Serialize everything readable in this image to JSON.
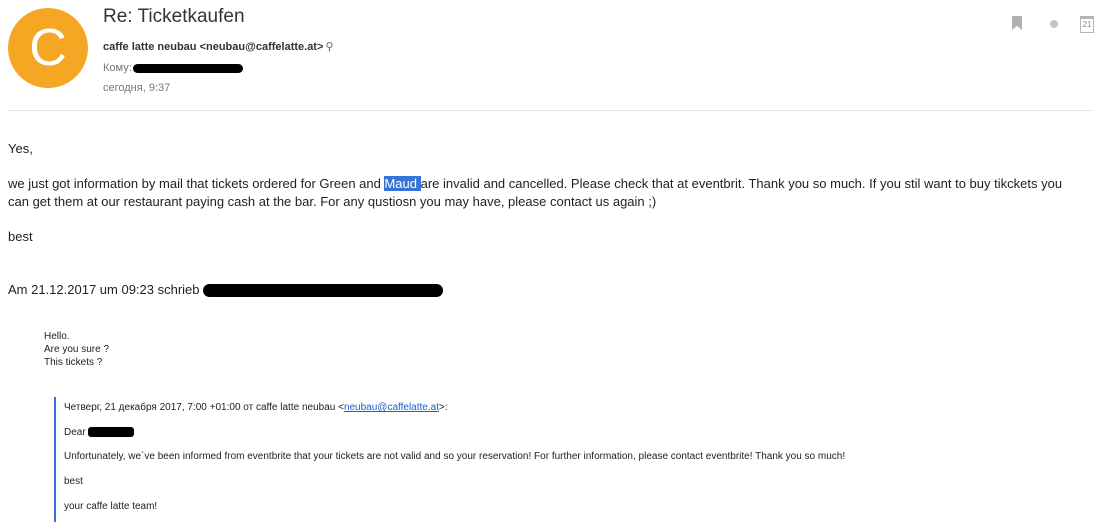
{
  "header": {
    "avatar_letter": "C",
    "subject": "Re: Ticketkaufen",
    "sender": "caffe latte neubau <neubau@caffelatte.at>",
    "to_label": "Кому:",
    "date": "сегодня, 9:37"
  },
  "icons": [
    "bookmark-icon",
    "status-dot-icon",
    "calendar-icon",
    "magnifier-icon"
  ],
  "body": {
    "greeting": "Yes,",
    "para_part1": "we just got information by mail that tickets ordered for Green and ",
    "para_highlight": "Maud ",
    "para_part2": "are invalid and cancelled. Please check that at eventbrit. Thank you so much. If you stil want to buy tikckets you",
    "para_line2": "can get them at our restaurant paying cash at the bar. For any qustiosn you may have, please contact us again ;)",
    "closing": "best",
    "quote_header": "Am 21.12.2017 um 09:23 schrieb"
  },
  "quote1": {
    "lines": [
      "Hello.",
      "Are you sure ?",
      "This tickets ?"
    ]
  },
  "quote2": {
    "header_prefix": "Четверг, 21 декабря 2017, 7:00 +01:00 от caffe latte neubau <",
    "header_email": "neubau@caffelatte.at",
    "header_suffix": ">:",
    "dear": "Dear",
    "text": "Unfortunately, we´ve been informed from eventbrite that your tickets are not valid and so your reservation! For further information, please contact eventbrite! Thank you so much!",
    "best": "best",
    "signature": "your caffe latte team!"
  },
  "colors": {
    "avatar": "#f5a623",
    "highlight": "#3874d8",
    "quote_border": "#3a6fd8",
    "link": "#1a5fd0"
  }
}
